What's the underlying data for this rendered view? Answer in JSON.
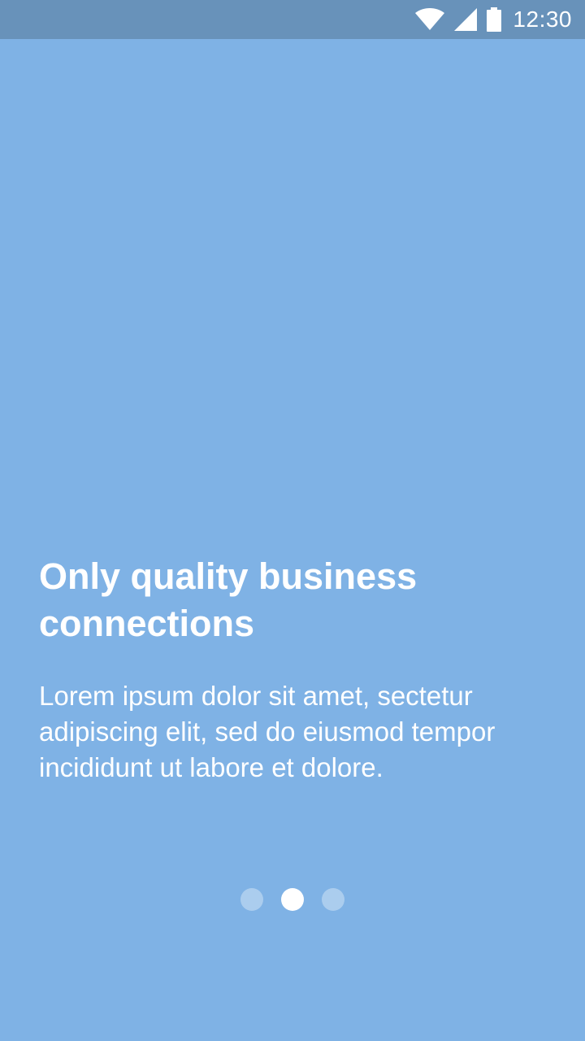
{
  "status_bar": {
    "time": "12:30",
    "icons": [
      "wifi-icon",
      "signal-icon",
      "battery-icon"
    ]
  },
  "slide": {
    "title": "Only quality business connections",
    "body": "Lorem ipsum dolor sit amet, sectetur adipiscing elit, sed do eiusmod tempor incididunt ut labore et dolore."
  },
  "pager": {
    "page_count": 3,
    "active_index": 1
  },
  "colors": {
    "background": "#7fb2e5",
    "status_bar": "#6892ba",
    "text": "#ffffff",
    "dot_inactive": "rgba(255,255,255,0.35)",
    "dot_active": "#ffffff"
  }
}
